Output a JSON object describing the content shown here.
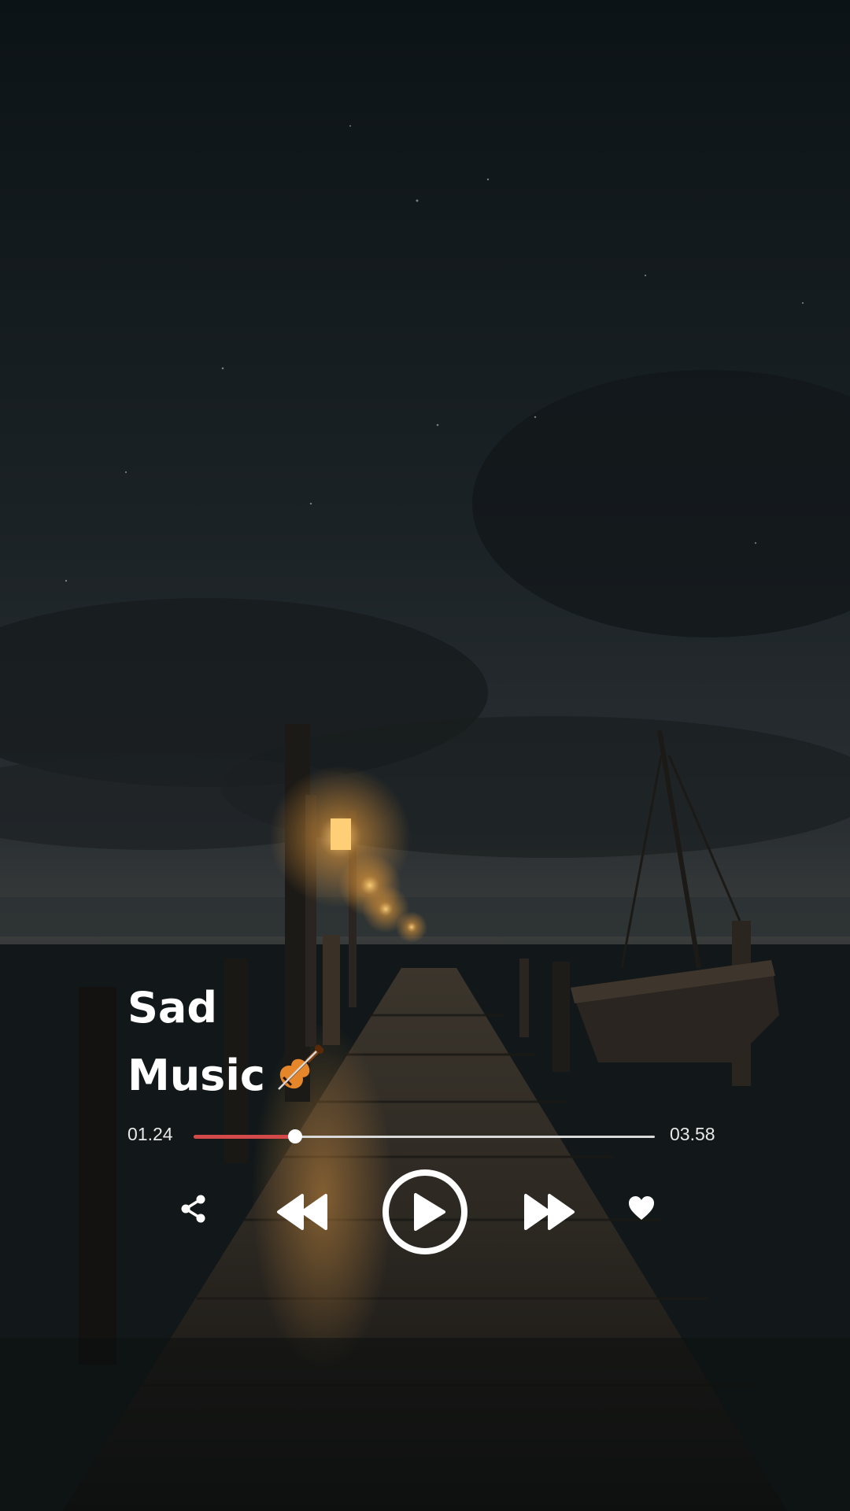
{
  "track": {
    "title_line1": "Sad",
    "title_line2": "Music",
    "emoji_icon": "violin-icon"
  },
  "progress": {
    "elapsed": "01.24",
    "total": "03.58",
    "fraction": 0.22
  },
  "controls": {
    "share_icon": "share-icon",
    "rewind_icon": "rewind-icon",
    "play_icon": "play-icon",
    "forward_icon": "fast-forward-icon",
    "like_icon": "heart-icon"
  },
  "colors": {
    "progress_fill": "#d44a4a",
    "track": "#d9d9d9",
    "foreground": "#ffffff"
  }
}
